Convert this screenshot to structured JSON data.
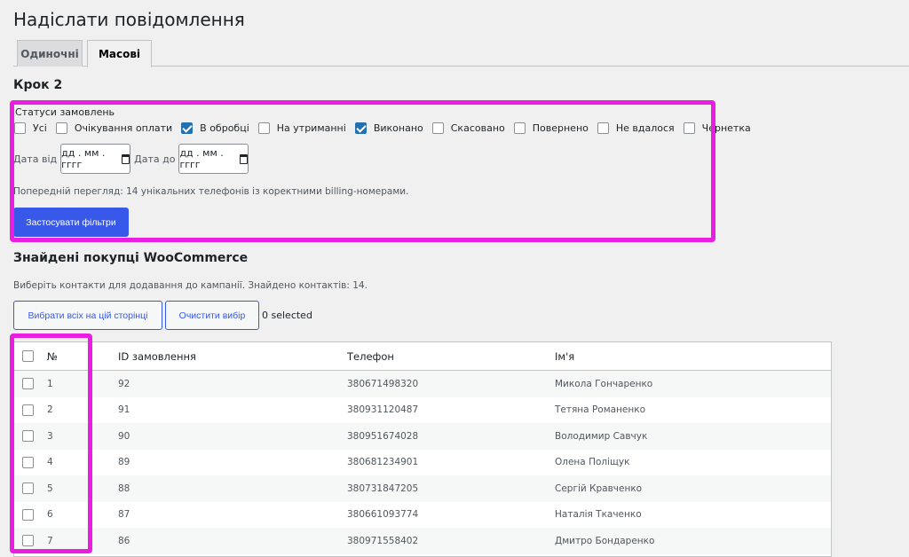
{
  "page": {
    "title": "Надіслати повідомлення"
  },
  "tabs": [
    {
      "label": "Одиночні",
      "active": false
    },
    {
      "label": "Масові",
      "active": true
    }
  ],
  "step": {
    "title": "Крок 2"
  },
  "filters": {
    "statuses_label": "Статуси замовлень",
    "statuses": [
      {
        "label": "Усі",
        "checked": false
      },
      {
        "label": "Очікування оплати",
        "checked": false
      },
      {
        "label": "В обробці",
        "checked": true
      },
      {
        "label": "На утриманні",
        "checked": false
      },
      {
        "label": "Виконано",
        "checked": true
      },
      {
        "label": "Скасовано",
        "checked": false
      },
      {
        "label": "Повернено",
        "checked": false
      },
      {
        "label": "Не вдалося",
        "checked": false
      },
      {
        "label": "Чернетка",
        "checked": false
      }
    ],
    "date_from_label": "Дата від",
    "date_from_placeholder": "дд . мм . гггг",
    "date_to_label": "Дата до",
    "date_to_placeholder": "дд . мм . гггг",
    "preview_text": "Попередній перегляд: 14 унікальних телефонів із коректними billing-номерами.",
    "apply_label": "Застосувати фільтри"
  },
  "customers": {
    "title": "Знайдені покупці WooCommerce",
    "description": "Виберіть контакти для додавання до кампанії. Знайдено контактів: 14.",
    "select_all_label": "Вибрати всіх на цій сторінці",
    "clear_label": "Очистити вибір",
    "selected_text": "0 selected",
    "columns": {
      "num": "№",
      "order_id": "ID замовлення",
      "phone": "Телефон",
      "name": "Ім'я"
    },
    "rows": [
      {
        "num": "1",
        "order_id": "92",
        "phone": "380671498320",
        "name": "Микола Гончаренко"
      },
      {
        "num": "2",
        "order_id": "91",
        "phone": "380931120487",
        "name": "Тетяна Романенко"
      },
      {
        "num": "3",
        "order_id": "90",
        "phone": "380951674028",
        "name": "Володимир Савчук"
      },
      {
        "num": "4",
        "order_id": "89",
        "phone": "380681234901",
        "name": "Олена Поліщук"
      },
      {
        "num": "5",
        "order_id": "88",
        "phone": "380731847205",
        "name": "Сергій Кравченко"
      },
      {
        "num": "6",
        "order_id": "87",
        "phone": "380661093774",
        "name": "Наталія Ткаченко"
      },
      {
        "num": "7",
        "order_id": "86",
        "phone": "380971558402",
        "name": "Дмитро Бондаренко"
      }
    ]
  },
  "colors": {
    "accent": "#3858e9",
    "highlight": "#e91ee0",
    "checkbox_checked": "#2271b1"
  }
}
